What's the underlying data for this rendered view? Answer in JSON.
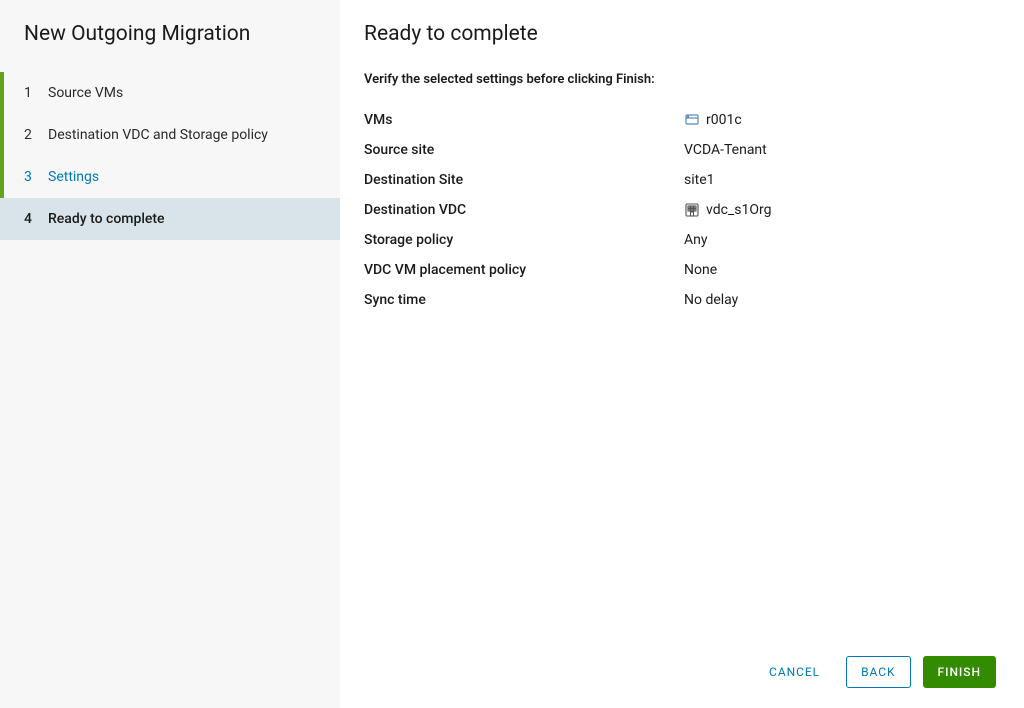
{
  "wizard": {
    "title": "New Outgoing Migration",
    "steps": [
      {
        "num": "1",
        "label": "Source VMs"
      },
      {
        "num": "2",
        "label": "Destination VDC and Storage policy"
      },
      {
        "num": "3",
        "label": "Settings"
      },
      {
        "num": "4",
        "label": "Ready to complete"
      }
    ]
  },
  "page": {
    "title": "Ready to complete",
    "instruction": "Verify the selected settings before clicking Finish:"
  },
  "summary": {
    "vms": {
      "label": "VMs",
      "value": "r001c"
    },
    "source_site": {
      "label": "Source site",
      "value": "VCDA-Tenant"
    },
    "dest_site": {
      "label": "Destination Site",
      "value": "site1"
    },
    "dest_vdc": {
      "label": "Destination VDC",
      "value": "vdc_s1Org"
    },
    "storage_policy": {
      "label": "Storage policy",
      "value": "Any"
    },
    "placement_policy": {
      "label": "VDC VM placement policy",
      "value": "None"
    },
    "sync_time": {
      "label": "Sync time",
      "value": "No delay"
    }
  },
  "footer": {
    "cancel": "CANCEL",
    "back": "BACK",
    "finish": "FINISH"
  }
}
